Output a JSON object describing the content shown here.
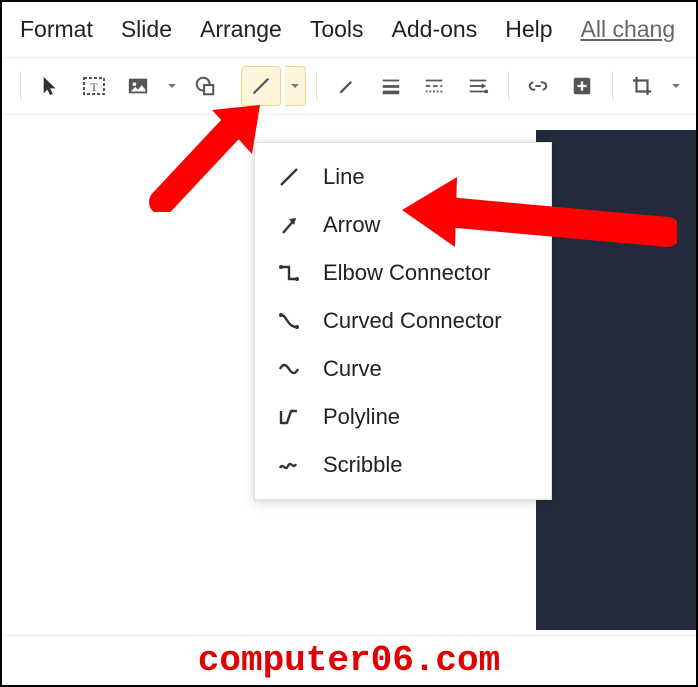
{
  "menubar": {
    "items": [
      "Format",
      "Slide",
      "Arrange",
      "Tools",
      "Add-ons",
      "Help"
    ],
    "link": "All chang"
  },
  "toolbar": {
    "select": "select-tool",
    "textbox": "textbox-tool",
    "image": "image-tool",
    "shape": "shape-tool",
    "line": "line-tool",
    "pencil": "paint-format-tool",
    "lines_style": "line-weight",
    "border_dash": "line-dash",
    "list": "list-tool",
    "link": "insert-link",
    "comment": "add-comment",
    "crop": "crop-tool"
  },
  "line_menu": {
    "items": [
      {
        "id": "line",
        "label": "Line"
      },
      {
        "id": "arrow",
        "label": "Arrow"
      },
      {
        "id": "elbow",
        "label": "Elbow Connector"
      },
      {
        "id": "curved",
        "label": "Curved Connector"
      },
      {
        "id": "curve",
        "label": "Curve"
      },
      {
        "id": "polyline",
        "label": "Polyline"
      },
      {
        "id": "scribble",
        "label": "Scribble"
      }
    ]
  },
  "watermark": "computer06.com",
  "colors": {
    "annotation": "#ff0000",
    "highlight_bg": "#fef4da",
    "slide_dark": "#232a3b"
  }
}
